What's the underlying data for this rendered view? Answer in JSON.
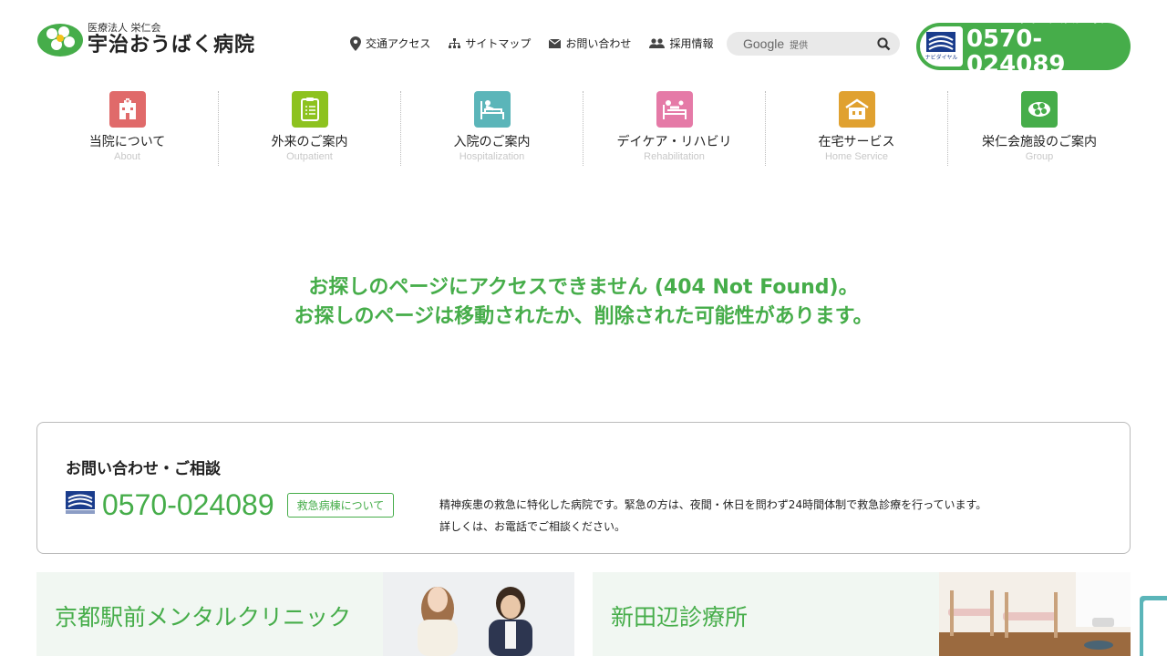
{
  "header": {
    "logo_sub": "医療法人 栄仁会",
    "logo_main": "宇治おうばく病院",
    "util_nav": [
      {
        "label": "交通アクセス",
        "icon": "map-pin-icon"
      },
      {
        "label": "サイトマップ",
        "icon": "sitemap-icon"
      },
      {
        "label": "お問い合わせ",
        "icon": "mail-icon"
      },
      {
        "label": "採用情報",
        "icon": "people-icon"
      }
    ],
    "search": {
      "google": "Google",
      "provided": "提供"
    },
    "phone": {
      "kana": "(ニジュウヨジカン オウバク)",
      "number": "0570-024089",
      "navidial": "ナビダイヤル"
    }
  },
  "main_nav": [
    {
      "label": "当院について",
      "en": "About",
      "color": "#e06a6a",
      "icon": "hospital-icon"
    },
    {
      "label": "外来のご案内",
      "en": "Outpatient",
      "color": "#8dc21f",
      "icon": "clipboard-icon"
    },
    {
      "label": "入院のご案内",
      "en": "Hospitalization",
      "color": "#5bb5b9",
      "icon": "bed-icon"
    },
    {
      "label": "デイケア・リハビリ",
      "en": "Rehabilitation",
      "color": "#e57aa7",
      "icon": "rehab-icon"
    },
    {
      "label": "在宅サービス",
      "en": "Home Service",
      "color": "#e0a130",
      "icon": "house-icon"
    },
    {
      "label": "栄仁会施設のご案内",
      "en": "Group",
      "color": "#46ad4a",
      "icon": "group-leaf-icon"
    }
  ],
  "notfound": {
    "line1": "お探しのページにアクセスできません (404 Not Found)。",
    "line2": "お探しのページは移動されたか、削除された可能性があります。"
  },
  "contact": {
    "title": "お問い合わせ・ご相談",
    "number": "0570-024089",
    "emergency_btn": "救急病棟について",
    "desc1": "精神疾患の救急に特化した病院です。緊急の方は、夜間・休日を問わず24時間体制で救急診療を行っています。",
    "desc2": "詳しくは、お電話でご相談ください。"
  },
  "banners": [
    {
      "title": "京都駅前メンタルクリニック"
    },
    {
      "title": "新田辺診療所"
    }
  ],
  "colors": {
    "brand_green": "#46ad4a"
  }
}
